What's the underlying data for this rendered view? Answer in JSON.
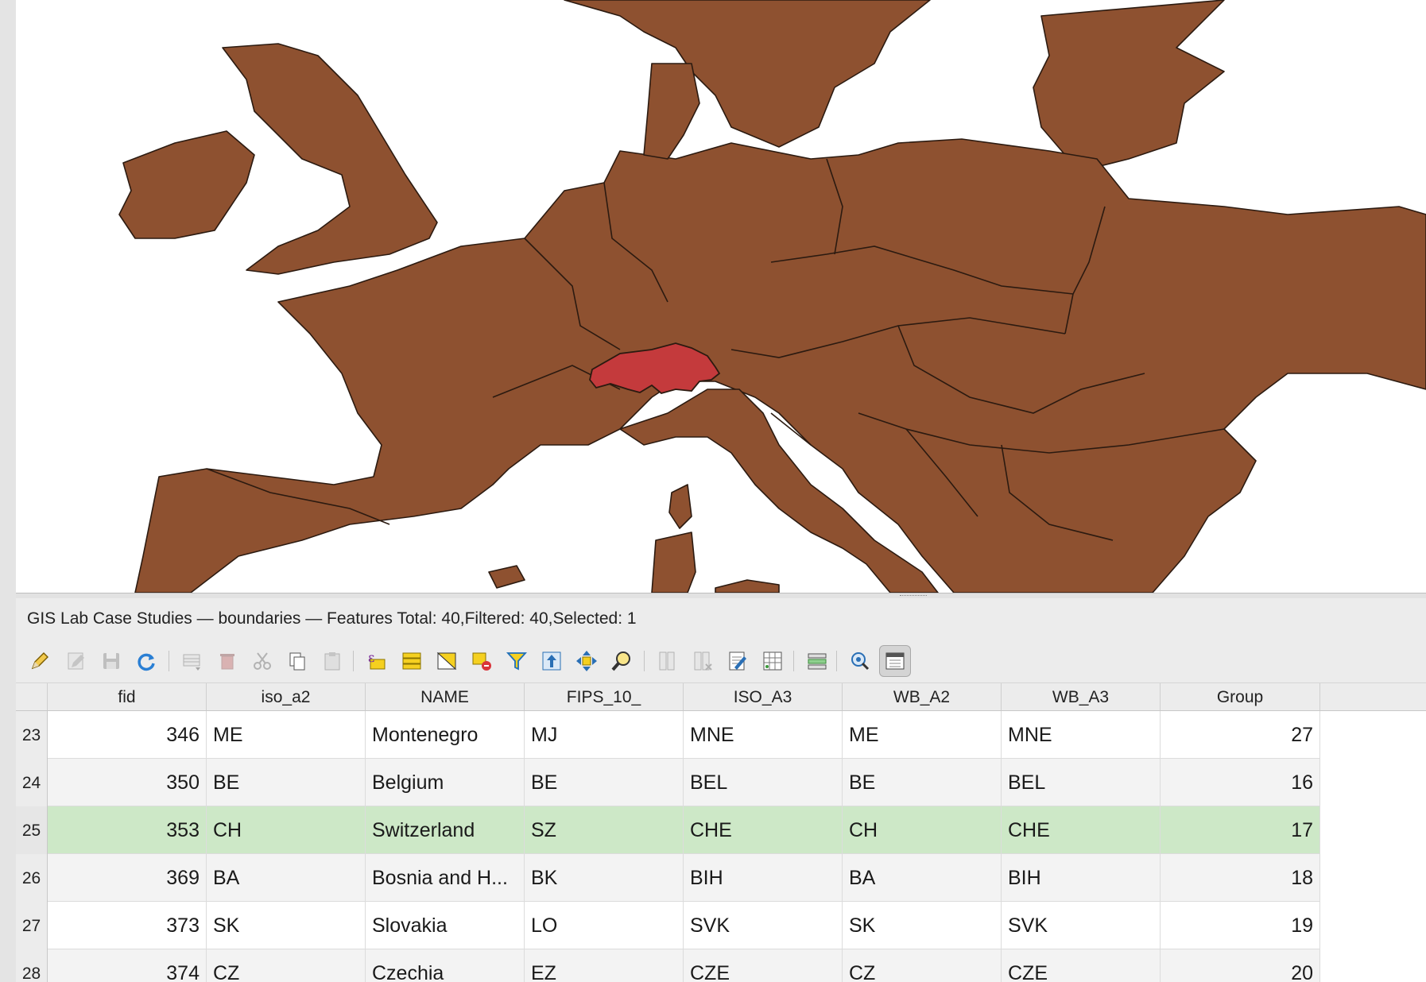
{
  "layer_title": "GIS Lab Case Studies — boundaries — Features Total: 40,Filtered: 40,Selected: 1",
  "colors": {
    "land": "#8e5130",
    "selected_feature": "#c43a3c",
    "map_background": "#ffffff",
    "selected_row": "#cde8c7",
    "alt_row": "#f3f3f3"
  },
  "map": {
    "selected_feature_name": "Switzerland"
  },
  "toolbar": [
    {
      "name": "toggle-editing-icon",
      "enabled": true
    },
    {
      "name": "toggle-multi-edit-icon",
      "enabled": false
    },
    {
      "name": "save-edits-icon",
      "enabled": false
    },
    {
      "name": "reload-table-icon",
      "enabled": true
    },
    {
      "name": "add-feature-icon",
      "enabled": false
    },
    {
      "name": "delete-feature-icon",
      "enabled": false
    },
    {
      "name": "cut-features-icon",
      "enabled": false
    },
    {
      "name": "copy-features-icon",
      "enabled": true
    },
    {
      "name": "paste-features-icon",
      "enabled": false
    },
    {
      "name": "select-by-expression-icon",
      "enabled": true
    },
    {
      "name": "select-all-icon",
      "enabled": true
    },
    {
      "name": "invert-selection-icon",
      "enabled": true
    },
    {
      "name": "deselect-all-icon",
      "enabled": true
    },
    {
      "name": "filter-select-icon",
      "enabled": true
    },
    {
      "name": "move-selection-top-icon",
      "enabled": true
    },
    {
      "name": "pan-to-selection-icon",
      "enabled": true
    },
    {
      "name": "zoom-to-selection-icon",
      "enabled": true
    },
    {
      "name": "new-field-icon",
      "enabled": false
    },
    {
      "name": "delete-field-icon",
      "enabled": false
    },
    {
      "name": "organize-columns-icon",
      "enabled": true
    },
    {
      "name": "field-calculator-icon",
      "enabled": true
    },
    {
      "name": "conditional-formatting-icon",
      "enabled": true
    },
    {
      "name": "actions-icon",
      "enabled": true
    },
    {
      "name": "dock-table-icon",
      "enabled": true
    }
  ],
  "table": {
    "columns": [
      "fid",
      "iso_a2",
      "NAME",
      "FIPS_10_",
      "ISO_A3",
      "WB_A2",
      "WB_A3",
      "Group"
    ],
    "rows": [
      {
        "row": "23",
        "fid": "346",
        "iso_a2": "ME",
        "NAME": "Montenegro",
        "FIPS_10_": "MJ",
        "ISO_A3": "MNE",
        "WB_A2": "ME",
        "WB_A3": "MNE",
        "Group": "27"
      },
      {
        "row": "24",
        "fid": "350",
        "iso_a2": "BE",
        "NAME": "Belgium",
        "FIPS_10_": "BE",
        "ISO_A3": "BEL",
        "WB_A2": "BE",
        "WB_A3": "BEL",
        "Group": "16"
      },
      {
        "row": "25",
        "fid": "353",
        "iso_a2": "CH",
        "NAME": "Switzerland",
        "FIPS_10_": "SZ",
        "ISO_A3": "CHE",
        "WB_A2": "CH",
        "WB_A3": "CHE",
        "Group": "17",
        "selected": true
      },
      {
        "row": "26",
        "fid": "369",
        "iso_a2": "BA",
        "NAME": "Bosnia and H...",
        "FIPS_10_": "BK",
        "ISO_A3": "BIH",
        "WB_A2": "BA",
        "WB_A3": "BIH",
        "Group": "18"
      },
      {
        "row": "27",
        "fid": "373",
        "iso_a2": "SK",
        "NAME": "Slovakia",
        "FIPS_10_": "LO",
        "ISO_A3": "SVK",
        "WB_A2": "SK",
        "WB_A3": "SVK",
        "Group": "19"
      },
      {
        "row": "28",
        "fid": "374",
        "iso_a2": "CZ",
        "NAME": "Czechia",
        "FIPS_10_": "EZ",
        "ISO_A3": "CZE",
        "WB_A2": "CZ",
        "WB_A3": "CZE",
        "Group": "20"
      }
    ]
  }
}
